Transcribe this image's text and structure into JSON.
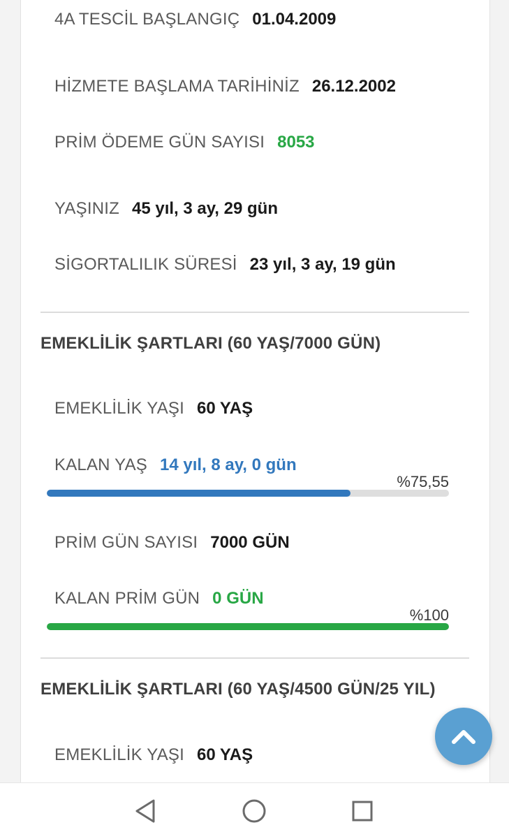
{
  "info": {
    "tescil_label": "4A TESCİL BAŞLANGIÇ",
    "tescil_value": "01.04.2009",
    "hizmet_label": "HİZMETE BAŞLAMA TARİHİNİZ",
    "hizmet_value": "26.12.2002",
    "prim_label": "PRİM ÖDEME GÜN SAYISI",
    "prim_value": "8053",
    "yas_label": "YAŞINIZ",
    "yas_value": "45 yıl, 3 ay, 29 gün",
    "sigorta_label": "SİGORTALILIK SÜRESİ",
    "sigorta_value": "23 yıl, 3 ay, 19 gün"
  },
  "section1": {
    "title": "EMEKLİLİK ŞARTLARI (60 YAŞ/7000 GÜN)",
    "emeklilik_yasi_label": "EMEKLİLİK YAŞI",
    "emeklilik_yasi_value": "60 YAŞ",
    "kalan_yas_label": "KALAN YAŞ",
    "kalan_yas_value": "14 yıl, 8 ay, 0 gün",
    "kalan_yas_percent_text": "%75,55",
    "kalan_yas_progress": 0.7555,
    "prim_gun_label": "PRİM GÜN SAYISI",
    "prim_gun_value": "7000 GÜN",
    "kalan_prim_label": "KALAN PRİM GÜN",
    "kalan_prim_value": "0 GÜN",
    "kalan_prim_percent_text": "%100",
    "kalan_prim_progress": 1.0
  },
  "section2": {
    "title": "EMEKLİLİK ŞARTLARI (60 YAŞ/4500 GÜN/25 YIL)",
    "emeklilik_yasi_label": "EMEKLİLİK YAŞI",
    "emeklilik_yasi_value": "60 YAŞ"
  },
  "colors": {
    "blue_bar": "#3278bd",
    "green_bar": "#28a745",
    "fab": "#5aa0d2"
  },
  "icons": {
    "fab": "chevron-up-icon",
    "nav_back": "triangle-back-icon",
    "nav_home": "circle-home-icon",
    "nav_recents": "square-recents-icon"
  }
}
